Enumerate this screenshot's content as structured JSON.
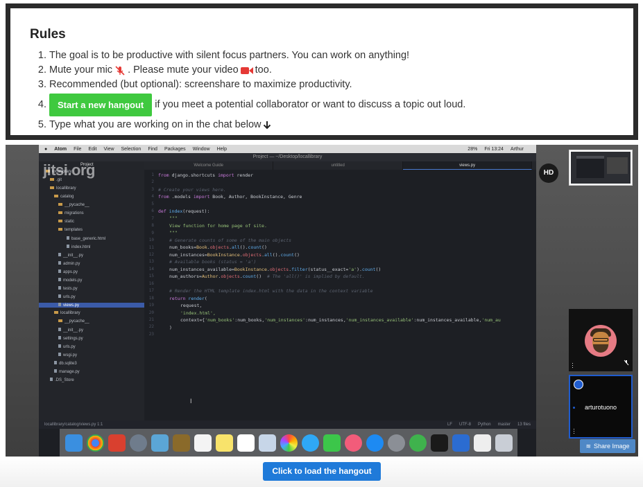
{
  "rules": {
    "title": "Rules",
    "items": [
      {
        "num": "1.",
        "text": "The goal is to be productive with silent focus partners. You can work on anything!"
      },
      {
        "num": "2.",
        "text_before": "Mute your mic",
        "text_mid": ". Please mute your video",
        "text_after": "too."
      },
      {
        "num": "3.",
        "text": "Recommended (but optional): screenshare to maximize productivity."
      },
      {
        "num": "4.",
        "button_label": "Start a new hangout",
        "text": "if you meet a potential collaborator or want to discuss a topic out loud."
      },
      {
        "num": "5.",
        "text": "Type what you are working on in the chat below"
      }
    ],
    "colors": {
      "button": "#3fc93f",
      "video_icon": "#e53935",
      "mic_icon": "#e53935"
    }
  },
  "video": {
    "watermark": "jitsi.org",
    "hd_badge": "HD",
    "share_image_label": "Share Image",
    "participant_name": "arturotuono",
    "mac_menubar": {
      "items": [
        "Atom",
        "File",
        "Edit",
        "View",
        "Selection",
        "Find",
        "Packages",
        "Window",
        "Help"
      ],
      "right": [
        "28%",
        "Fri 13:24",
        "Arthur"
      ]
    },
    "atom_title": "Project — ~/Desktop/locallibrary",
    "tabs": [
      "Welcome Guide",
      "untitled",
      "views.py"
    ],
    "tree_header": "Project",
    "tree": [
      {
        "label": "locallibrary",
        "kind": "folder"
      },
      {
        "label": ".git",
        "kind": "folder"
      },
      {
        "label": "locallibrary",
        "kind": "folder"
      },
      {
        "label": "catalog",
        "kind": "folder"
      },
      {
        "label": "__pycache__",
        "kind": "folder"
      },
      {
        "label": "migrations",
        "kind": "folder"
      },
      {
        "label": "static",
        "kind": "folder"
      },
      {
        "label": "templates",
        "kind": "folder"
      },
      {
        "label": "base_generic.html",
        "kind": "file"
      },
      {
        "label": "index.html",
        "kind": "file"
      },
      {
        "label": "__init__.py",
        "kind": "file"
      },
      {
        "label": "admin.py",
        "kind": "file"
      },
      {
        "label": "apps.py",
        "kind": "file"
      },
      {
        "label": "models.py",
        "kind": "file"
      },
      {
        "label": "tests.py",
        "kind": "file"
      },
      {
        "label": "urls.py",
        "kind": "file"
      },
      {
        "label": "views.py",
        "kind": "file"
      },
      {
        "label": "locallibrary",
        "kind": "folder"
      },
      {
        "label": "__pycache__",
        "kind": "folder"
      },
      {
        "label": "__init__.py",
        "kind": "file"
      },
      {
        "label": "settings.py",
        "kind": "file"
      },
      {
        "label": "urls.py",
        "kind": "file"
      },
      {
        "label": "wsgi.py",
        "kind": "file"
      },
      {
        "label": "db.sqlite3",
        "kind": "file"
      },
      {
        "label": "manage.py",
        "kind": "file"
      },
      {
        "label": ".DS_Store",
        "kind": "file"
      }
    ],
    "line_numbers": [
      "1",
      "2",
      "3",
      "4",
      "5",
      "6",
      "7",
      "8",
      "9",
      "10",
      "11",
      "12",
      "13",
      "14",
      "15",
      "16",
      "17",
      "18",
      "19",
      "20",
      "21",
      "22",
      "23"
    ],
    "status_left": "locallibrary/catalog/views.py   1:1",
    "status_right": [
      "LF",
      "UTF-8",
      "Python",
      "master",
      "13 files"
    ]
  },
  "bottom": {
    "load_label": "Click to load the hangout",
    "button_color": "#1f7ad9"
  }
}
